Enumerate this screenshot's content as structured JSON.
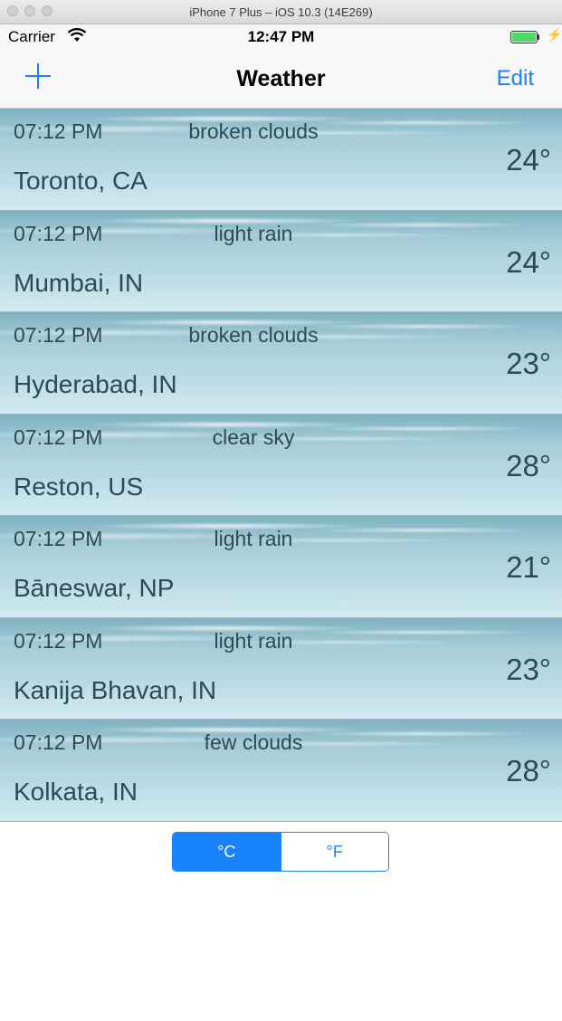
{
  "window": {
    "title": "iPhone 7 Plus – iOS 10.3 (14E269)"
  },
  "status_bar": {
    "carrier": "Carrier",
    "time": "12:47 PM",
    "battery_color": "#4cd964"
  },
  "nav": {
    "title": "Weather",
    "edit_label": "Edit",
    "add_icon": "plus-icon",
    "accent": "#1a82fb"
  },
  "rows": [
    {
      "time": "07:12 PM",
      "description": "broken clouds",
      "city": "Toronto, CA",
      "temp": "24°"
    },
    {
      "time": "07:12 PM",
      "description": "light rain",
      "city": "Mumbai, IN",
      "temp": "24°"
    },
    {
      "time": "07:12 PM",
      "description": "broken clouds",
      "city": "Hyderabad, IN",
      "temp": "23°"
    },
    {
      "time": "07:12 PM",
      "description": "clear sky",
      "city": "Reston, US",
      "temp": "28°"
    },
    {
      "time": "07:12 PM",
      "description": "light rain",
      "city": "Bāneswar, NP",
      "temp": "21°"
    },
    {
      "time": "07:12 PM",
      "description": "light rain",
      "city": "Kanija Bhavan, IN",
      "temp": "23°"
    },
    {
      "time": "07:12 PM",
      "description": "few clouds",
      "city": "Kolkata, IN",
      "temp": "28°"
    }
  ],
  "units": {
    "celsius": "°C",
    "fahrenheit": "°F",
    "selected": "°C"
  }
}
